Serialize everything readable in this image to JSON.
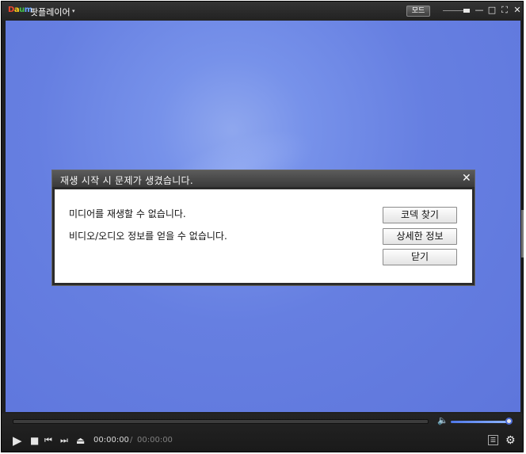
{
  "window": {
    "logo_text": "Daum",
    "app_title": "팟플레이어",
    "mode_label": "모드",
    "title_controls": {
      "caret": "▾",
      "minimize": "—",
      "maximize": "□",
      "fullscreen": "⛶",
      "close": "✕"
    }
  },
  "dialog": {
    "title": "재생 시작 시 문제가 생겼습니다.",
    "messages": [
      "미디어를 재생할 수 없습니다.",
      "비디오/오디오 정보를 얻을 수 없습니다."
    ],
    "buttons": [
      "코덱 찾기",
      "상세한 정보",
      "닫기"
    ],
    "close_glyph": "✕"
  },
  "controls": {
    "time_current": "00:00:00",
    "time_separator": "/",
    "time_total": "00:00:00",
    "volume_level": 0.95,
    "icons": {
      "play": "▶",
      "stop": "■",
      "previous": "⏮",
      "next": "⏭",
      "eject": "⏏",
      "volume": "🔈",
      "playlist": "☰",
      "settings": "⚙"
    }
  },
  "colors": {
    "background": "#6a86e4",
    "chrome": "#1f1f20",
    "accent": "#4d6cd6"
  }
}
